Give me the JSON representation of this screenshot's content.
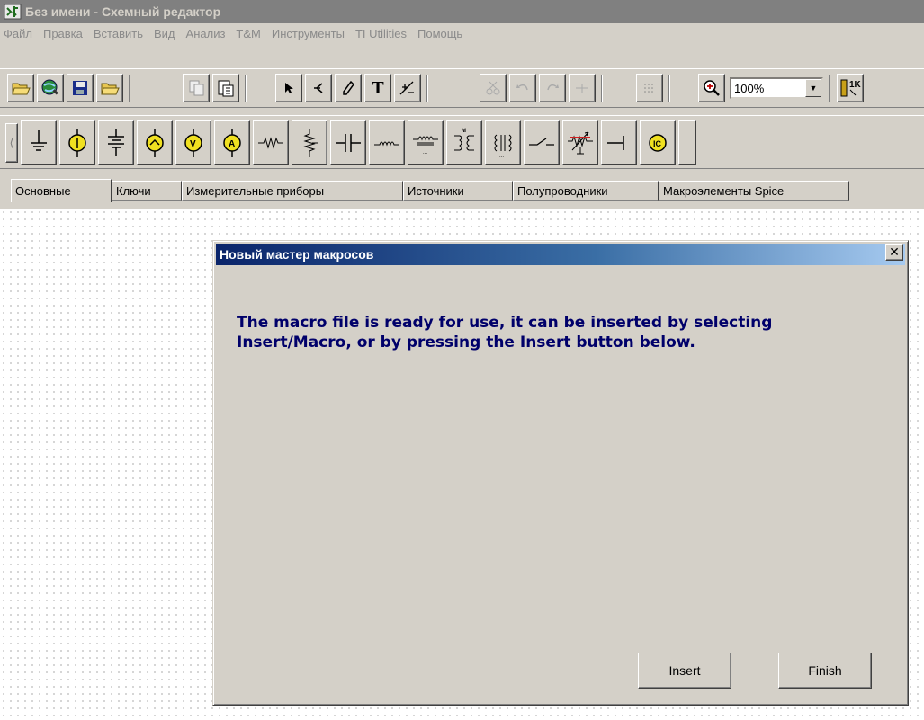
{
  "window": {
    "title": "Без имени - Схемный редактор"
  },
  "menu": [
    "Файл",
    "Правка",
    "Вставить",
    "Вид",
    "Анализ",
    "T&M",
    "Инструменты",
    "TI Utilities",
    "Помощь"
  ],
  "toolbar": {
    "zoom_value": "100%",
    "text_tool_label": "T",
    "ic_label": "1K"
  },
  "tabs": [
    {
      "label": "Основные",
      "active": true
    },
    {
      "label": "Ключи",
      "active": false
    },
    {
      "label": "Измерительные приборы",
      "active": false
    },
    {
      "label": "Источники",
      "active": false
    },
    {
      "label": "Полупроводники",
      "active": false
    },
    {
      "label": "Макроэлементы Spice",
      "active": false
    }
  ],
  "dialog": {
    "title": "Новый мастер макросов",
    "message_line1": "The macro file is ready for use, it can be inserted by selecting",
    "message_line2": "Insert/Macro, or by pressing the Insert button below.",
    "insert_label": "Insert",
    "finish_label": "Finish"
  },
  "colors": {
    "title_inactive": "#808080",
    "dialog_title_start": "#0a246a",
    "dialog_title_end": "#a6caf0",
    "message_text": "#00006a",
    "face": "#d4d0c8"
  }
}
